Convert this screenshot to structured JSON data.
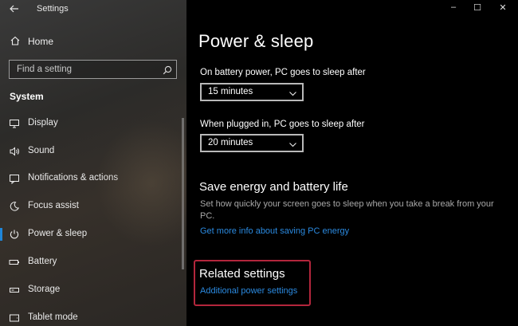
{
  "window": {
    "title": "Settings",
    "minimize": "–",
    "maximize": "☐",
    "close": "✕"
  },
  "sidebar": {
    "home_label": "Home",
    "search": {
      "placeholder": "Find a setting",
      "value": ""
    },
    "section_label": "System",
    "items": [
      {
        "label": "Display",
        "icon": "display-icon",
        "active": false
      },
      {
        "label": "Sound",
        "icon": "speaker-icon",
        "active": false
      },
      {
        "label": "Notifications & actions",
        "icon": "notifications-icon",
        "active": false
      },
      {
        "label": "Focus assist",
        "icon": "moon-icon",
        "active": false
      },
      {
        "label": "Power & sleep",
        "icon": "power-icon",
        "active": true
      },
      {
        "label": "Battery",
        "icon": "battery-icon",
        "active": false
      },
      {
        "label": "Storage",
        "icon": "storage-icon",
        "active": false
      },
      {
        "label": "Tablet mode",
        "icon": "tablet-icon",
        "active": false
      }
    ]
  },
  "main": {
    "title": "Power & sleep",
    "battery_sleep": {
      "label": "On battery power, PC goes to sleep after",
      "value": "15 minutes"
    },
    "plugged_sleep": {
      "label": "When plugged in, PC goes to sleep after",
      "value": "20 minutes"
    },
    "save_energy": {
      "heading": "Save energy and battery life",
      "description": "Set how quickly your screen goes to sleep when you take a break from your PC.",
      "link": "Get more info about saving PC energy"
    },
    "related": {
      "heading": "Related settings",
      "link": "Additional power settings"
    }
  },
  "colors": {
    "accent": "#1f86d9",
    "link": "#2b8ae0",
    "highlight": "#b3263c"
  }
}
